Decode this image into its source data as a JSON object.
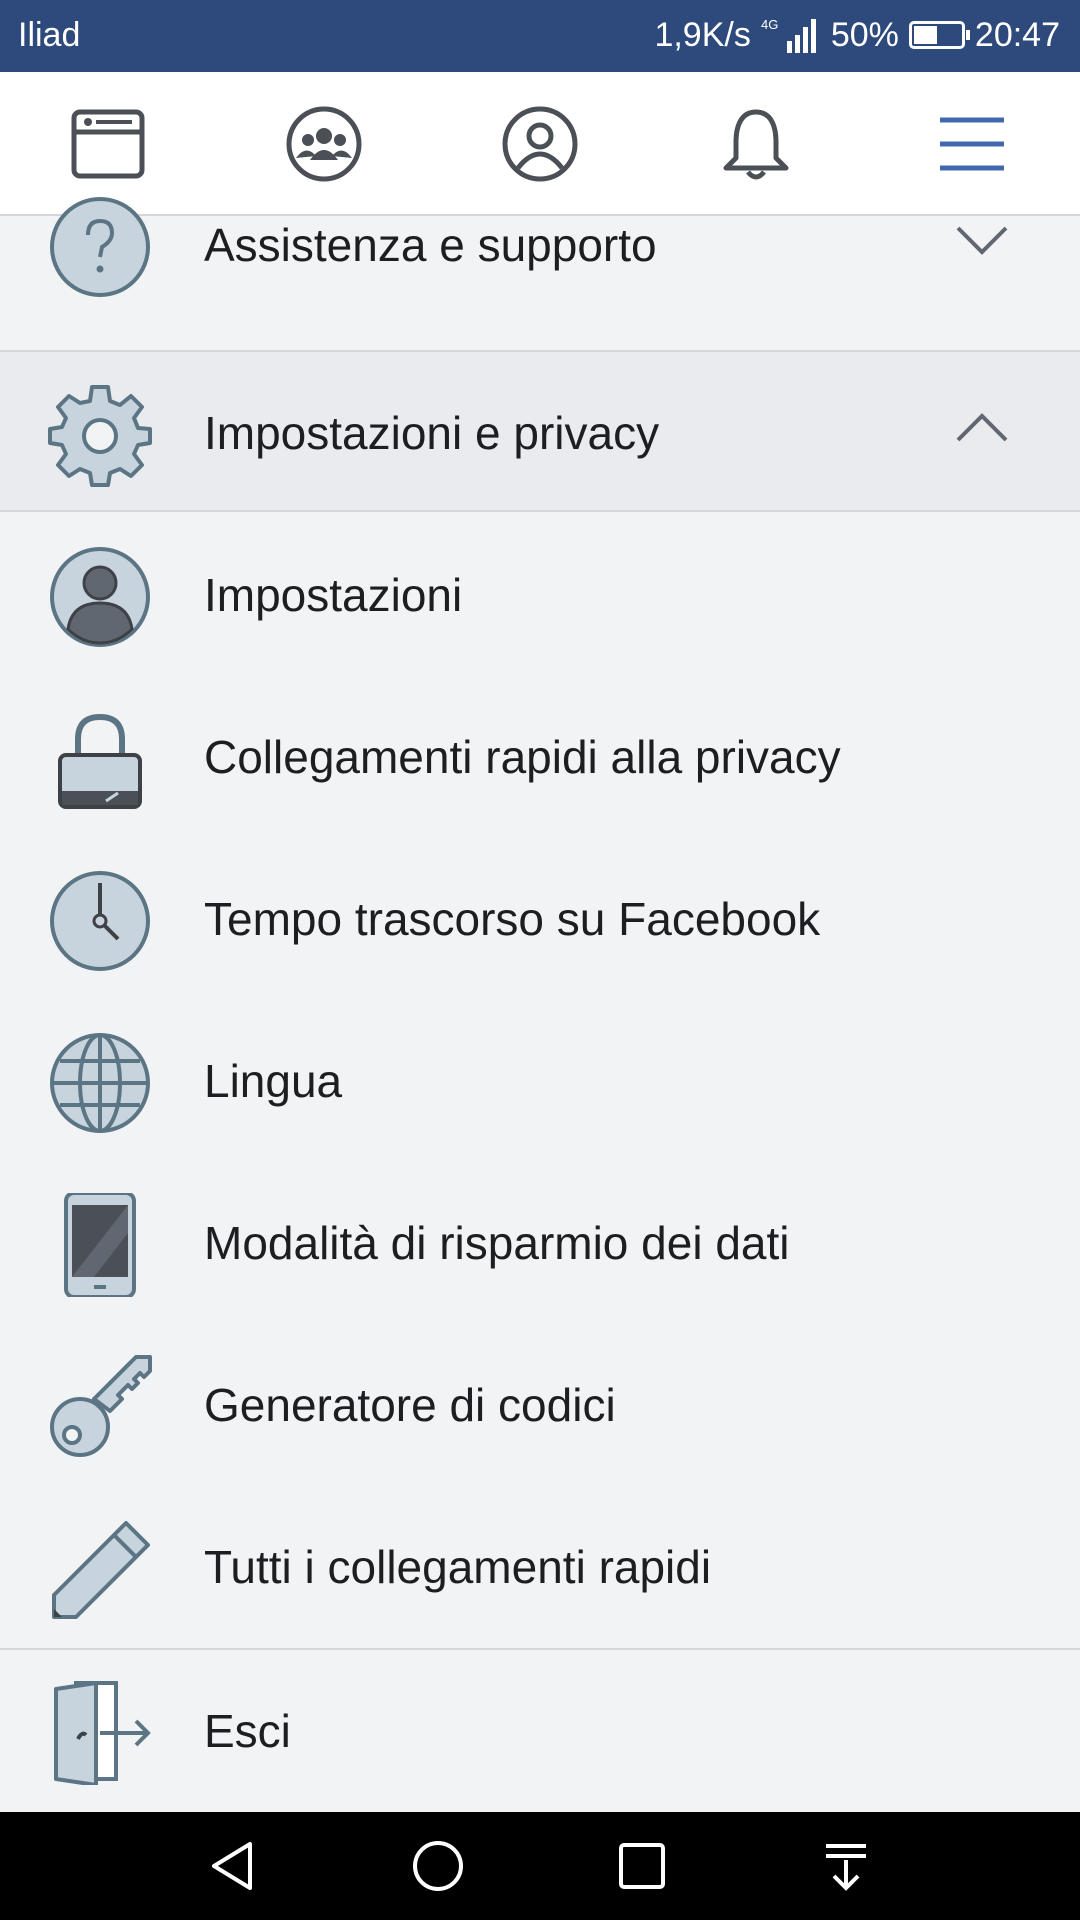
{
  "status_bar": {
    "carrier": "Iliad",
    "speed": "1,9K/s",
    "network": "4G",
    "battery": "50%",
    "battery_level": 0.5,
    "time": "20:47"
  },
  "topnav": {
    "items": [
      {
        "name": "news-feed-icon"
      },
      {
        "name": "groups-icon"
      },
      {
        "name": "profile-icon"
      },
      {
        "name": "notifications-bell-icon"
      },
      {
        "name": "menu-hamburger-icon"
      }
    ],
    "active_color": "#4267b2"
  },
  "menu": {
    "help": {
      "label": "Assistenza e supporto",
      "icon": "question-circle-icon"
    },
    "settings_privacy": {
      "label": "Impostazioni e privacy",
      "icon": "gear-icon",
      "expanded": true
    },
    "items": [
      {
        "label": "Impostazioni",
        "icon": "user-avatar-icon"
      },
      {
        "label": "Collegamenti rapidi alla privacy",
        "icon": "lock-icon"
      },
      {
        "label": "Tempo trascorso su Facebook",
        "icon": "clock-icon"
      },
      {
        "label": "Lingua",
        "icon": "globe-icon"
      },
      {
        "label": "Modalità di risparmio dei dati",
        "icon": "phone-icon"
      },
      {
        "label": "Generatore di codici",
        "icon": "key-icon"
      },
      {
        "label": "Tutti i collegamenti rapidi",
        "icon": "pencil-icon"
      }
    ],
    "logout": {
      "label": "Esci",
      "icon": "exit-door-icon"
    }
  },
  "system_nav": {
    "buttons": [
      "back-icon",
      "home-icon",
      "recents-icon",
      "notifications-pull-icon"
    ]
  }
}
